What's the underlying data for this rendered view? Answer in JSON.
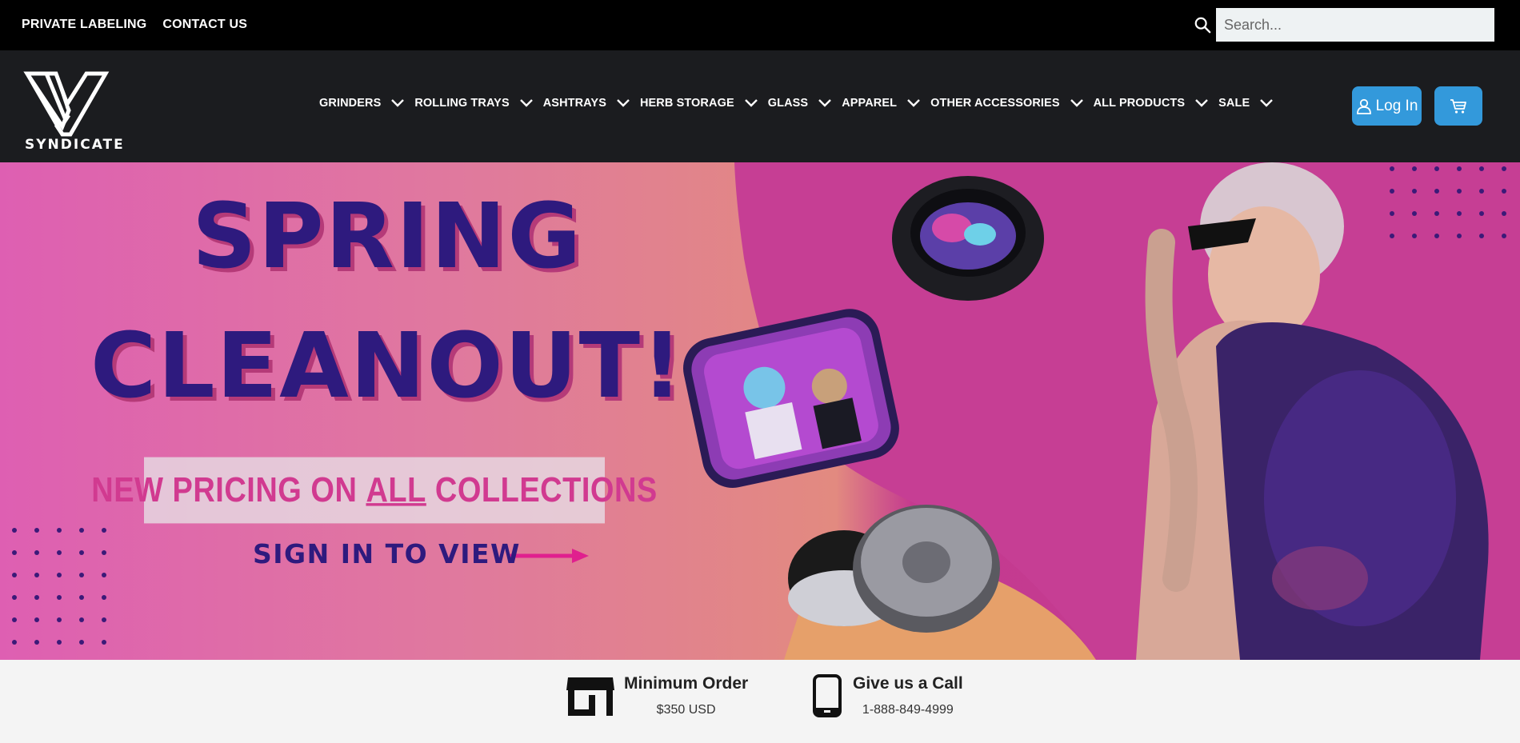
{
  "topbar": {
    "links": [
      "PRIVATE LABELING",
      "CONTACT US"
    ],
    "search_placeholder": "Search..."
  },
  "brand": {
    "name": "SYNDICATE",
    "logo_mark": "V-icon"
  },
  "nav": {
    "items": [
      "GRINDERS",
      "ROLLING TRAYS",
      "ASHTRAYS",
      "HERB STORAGE",
      "GLASS",
      "APPAREL",
      "OTHER ACCESSORIES",
      "ALL PRODUCTS",
      "SALE"
    ],
    "login_label": "Log In",
    "login_icon": "user-icon",
    "cart_icon": "cart-icon"
  },
  "hero": {
    "line1": "SPRING",
    "line2": "CLEANOUT!",
    "pricing_pre": "NEW PRICING ON ",
    "pricing_underlined": "ALL",
    "pricing_post": " COLLECTIONS",
    "cta": "SIGN IN TO VIEW",
    "colors": {
      "title": "#2e1a7e",
      "accent_pink": "#e0208e",
      "bg_magenta": "#c63e94"
    }
  },
  "info": {
    "min_order_title": "Minimum Order",
    "min_order_value": "$350 USD",
    "call_title": "Give us a Call",
    "call_value": "1-888-849-4999"
  },
  "colors": {
    "topbar": "#000000",
    "navbar": "#1b1c1f",
    "button": "#3399db"
  }
}
